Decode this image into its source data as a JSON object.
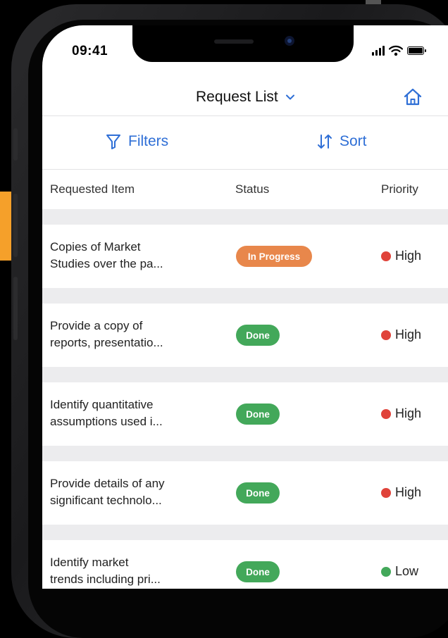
{
  "status_bar": {
    "time": "09:41"
  },
  "navbar": {
    "title": "Request List"
  },
  "toolbar": {
    "filters_label": "Filters",
    "sort_label": "Sort"
  },
  "table": {
    "headers": [
      "Requested Item",
      "Status",
      "Priority"
    ],
    "rows": [
      {
        "item_line1": "Copies of Market",
        "item_line2": "Studies over the pa...",
        "status": "In Progress",
        "status_type": "progress",
        "priority": "High",
        "priority_color": "#e0433a"
      },
      {
        "item_line1": "Provide a copy of",
        "item_line2": "reports, presentatio...",
        "status": "Done",
        "status_type": "done",
        "priority": "High",
        "priority_color": "#e0433a"
      },
      {
        "item_line1": "Identify quantitative",
        "item_line2": "assumptions used i...",
        "status": "Done",
        "status_type": "done",
        "priority": "High",
        "priority_color": "#e0433a"
      },
      {
        "item_line1": "Provide details of any",
        "item_line2": "significant technolo...",
        "status": "Done",
        "status_type": "done",
        "priority": "High",
        "priority_color": "#e0433a"
      },
      {
        "item_line1": "Identify market",
        "item_line2": "trends including pri...",
        "status": "Done",
        "status_type": "done",
        "priority": "Low",
        "priority_color": "#43a85a"
      }
    ]
  },
  "colors": {
    "accent": "#2f6fd6",
    "in_progress": "#e8874b",
    "done": "#43a85a",
    "high": "#e0433a",
    "low": "#43a85a",
    "side_tab": "#f5a02a"
  },
  "icons": {
    "navbar": [
      "chevron-down-icon",
      "home-icon"
    ],
    "toolbar": [
      "filter-icon",
      "sort-icon"
    ],
    "status_bar": [
      "signal-icon",
      "wifi-icon",
      "battery-icon"
    ]
  }
}
